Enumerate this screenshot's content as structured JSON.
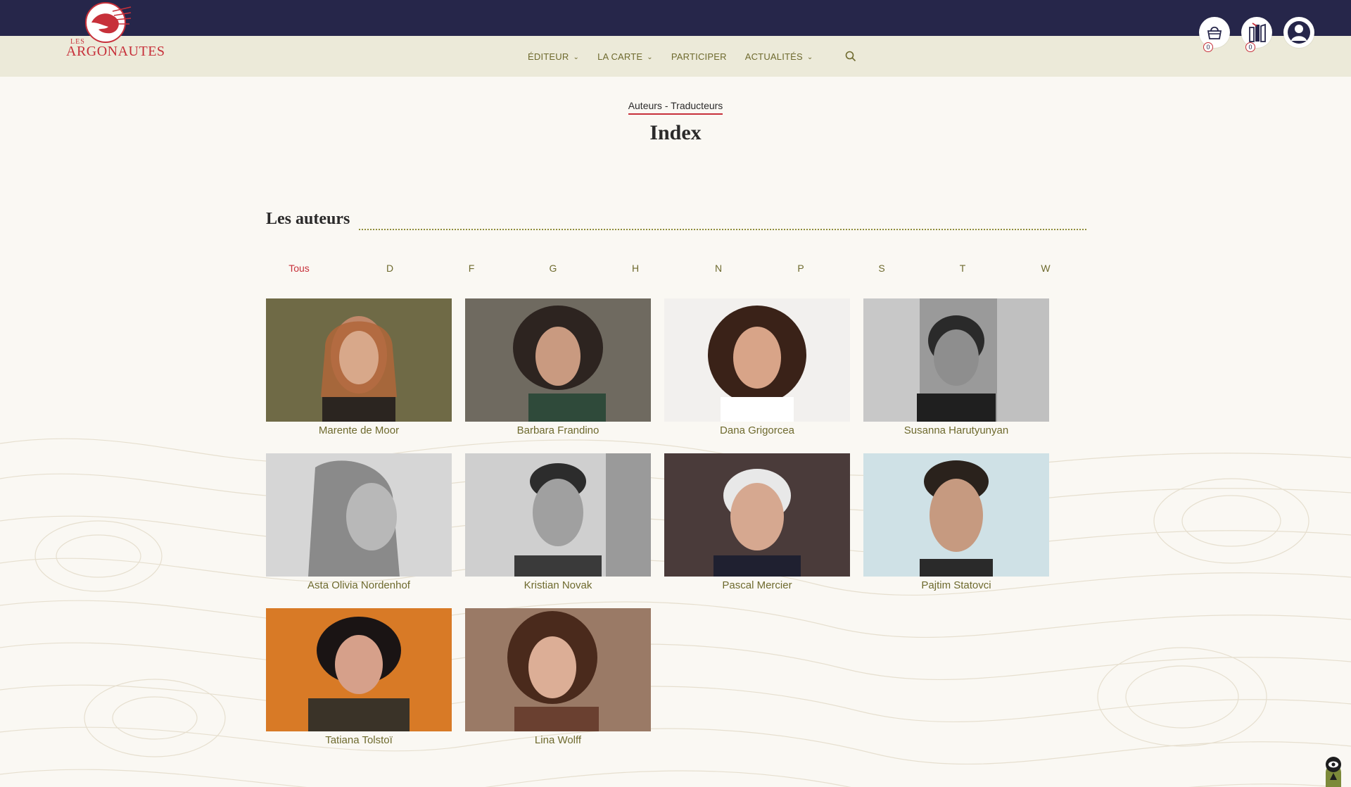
{
  "header": {
    "logo_small": "LES",
    "logo_name": "ARGONAUTES",
    "nav": [
      {
        "label": "ÉDITEUR",
        "dropdown": true
      },
      {
        "label": "LA CARTE",
        "dropdown": true
      },
      {
        "label": "PARTICIPER",
        "dropdown": false
      },
      {
        "label": "ACTUALITÉS",
        "dropdown": true
      }
    ],
    "icons": {
      "basket_count": "0",
      "books_count": "0"
    }
  },
  "page": {
    "breadcrumb": "Auteurs - Traducteurs",
    "title": "Index"
  },
  "section": {
    "title": "Les auteurs",
    "filters": [
      "Tous",
      "D",
      "F",
      "G",
      "H",
      "N",
      "P",
      "S",
      "T",
      "W"
    ],
    "active_filter": "Tous"
  },
  "authors": [
    {
      "name": "Marente de Moor"
    },
    {
      "name": "Barbara Frandino"
    },
    {
      "name": "Dana Grigorcea"
    },
    {
      "name": "Susanna Harutyunyan"
    },
    {
      "name": "Asta Olivia Nordenhof"
    },
    {
      "name": "Kristian Novak"
    },
    {
      "name": "Pascal Mercier"
    },
    {
      "name": "Pajtim Statovci"
    },
    {
      "name": "Tatiana Tolstoï"
    },
    {
      "name": "Lina Wolff"
    }
  ],
  "colors": {
    "topbar": "#26264a",
    "navbar": "#ecead9",
    "accent": "#c7303a",
    "olive": "#6e6a2e"
  }
}
